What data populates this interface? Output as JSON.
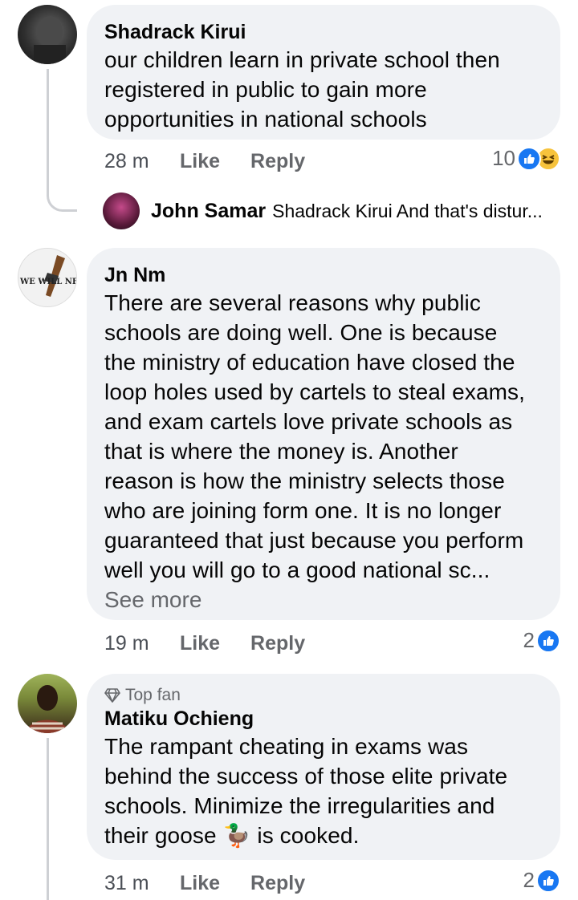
{
  "colors": {
    "bubble": "#f0f2f5",
    "like_blue": "#1877f2",
    "meta_gray": "#65676b",
    "thread_line": "#ced0d4"
  },
  "comments": [
    {
      "author": "Shadrack Kirui",
      "text": [
        "our children learn in private school then",
        "registered in public to gain more",
        "opportunities in national schools"
      ],
      "time": "28 m",
      "like": "Like",
      "reply": "Reply",
      "reaction_count": "10",
      "reactions": [
        "like-icon",
        "haha-icon"
      ],
      "reply_preview": {
        "author": "John Samar",
        "snippet": "Shadrack Kirui And that's distur..."
      }
    },
    {
      "author": "Jn Nm",
      "text": [
        "There are several reasons why public",
        "schools are doing well. One is because",
        "the ministry of education have closed the",
        "loop holes used by cartels to steal exams,",
        "and exam cartels love private schools as",
        "that is where the money is. Another",
        "reason is how the ministry selects those",
        "who are joining form one. It is no longer",
        "guaranteed that just because you perform",
        "well you will go to a good national sc..."
      ],
      "see_more": "See more",
      "avatar_text": "WE WILL NEVER",
      "time": "19 m",
      "like": "Like",
      "reply": "Reply",
      "reaction_count": "2",
      "reactions": [
        "like-icon"
      ]
    },
    {
      "badge": "Top fan",
      "author": "Matiku Ochieng",
      "text": [
        "The rampant cheating in exams was",
        "behind the success of those elite private",
        "schools. Minimize the irregularities and"
      ],
      "last_line_before": "their goose ",
      "emoji": "🦆",
      "last_line_after": " is cooked.",
      "time": "31 m",
      "like": "Like",
      "reply": "Reply",
      "reaction_count": "2",
      "reactions": [
        "like-icon"
      ]
    }
  ]
}
